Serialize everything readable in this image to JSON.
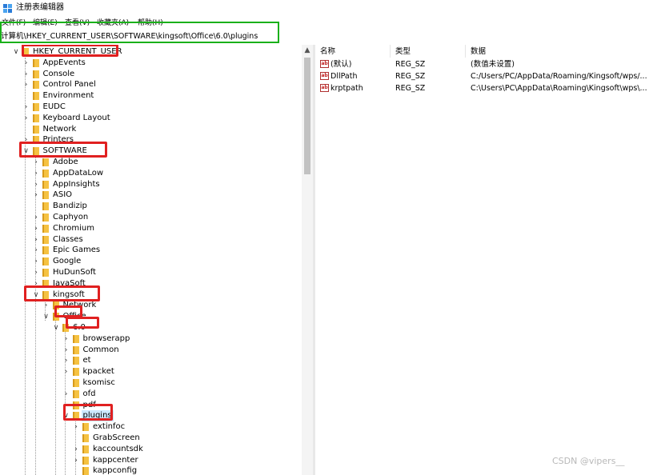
{
  "window": {
    "title": "注册表编辑器",
    "icon": "registry-editor-icon"
  },
  "menu": [
    "文件(F)",
    "编辑(E)",
    "查看(V)",
    "收藏夹(A)",
    "帮助(H)"
  ],
  "address": "计算机\\HKEY_CURRENT_USER\\SOFTWARE\\kingsoft\\Office\\6.0\\plugins",
  "tree": [
    {
      "label": "HKEY_CURRENT_USER",
      "chevron": "v"
    },
    {
      "label": "AppEvents",
      "chevron": ">"
    },
    {
      "label": "Console",
      "chevron": ">"
    },
    {
      "label": "Control Panel",
      "chevron": ">"
    },
    {
      "label": "Environment",
      "chevron": ""
    },
    {
      "label": "EUDC",
      "chevron": ">"
    },
    {
      "label": "Keyboard Layout",
      "chevron": ">"
    },
    {
      "label": "Network",
      "chevron": ""
    },
    {
      "label": "Printers",
      "chevron": ">"
    },
    {
      "label": "SOFTWARE",
      "chevron": "v"
    },
    {
      "label": "Adobe",
      "chevron": ">"
    },
    {
      "label": "AppDataLow",
      "chevron": ">"
    },
    {
      "label": "AppInsights",
      "chevron": ">"
    },
    {
      "label": "ASIO",
      "chevron": ">"
    },
    {
      "label": "Bandizip",
      "chevron": ""
    },
    {
      "label": "Caphyon",
      "chevron": ">"
    },
    {
      "label": "Chromium",
      "chevron": ">"
    },
    {
      "label": "Classes",
      "chevron": ">"
    },
    {
      "label": "Epic Games",
      "chevron": ">"
    },
    {
      "label": "Google",
      "chevron": ">"
    },
    {
      "label": "HuDunSoft",
      "chevron": ">"
    },
    {
      "label": "JavaSoft",
      "chevron": ">"
    },
    {
      "label": "kingsoft",
      "chevron": "v"
    },
    {
      "label": "Network",
      "chevron": ">"
    },
    {
      "label": "Office",
      "chevron": "v"
    },
    {
      "label": "6.0",
      "chevron": "v"
    },
    {
      "label": "browserapp",
      "chevron": ">"
    },
    {
      "label": "Common",
      "chevron": ">"
    },
    {
      "label": "et",
      "chevron": ">"
    },
    {
      "label": "kpacket",
      "chevron": ">"
    },
    {
      "label": "ksomisc",
      "chevron": ""
    },
    {
      "label": "ofd",
      "chevron": ">"
    },
    {
      "label": "pdf",
      "chevron": ">"
    },
    {
      "label": "plugins",
      "chevron": "v",
      "selected": true
    },
    {
      "label": "extinfoc",
      "chevron": ">"
    },
    {
      "label": "GrabScreen",
      "chevron": ""
    },
    {
      "label": "kaccountsdk",
      "chevron": ">"
    },
    {
      "label": "kappcenter",
      "chevron": ">"
    },
    {
      "label": "kappconfig",
      "chevron": ""
    }
  ],
  "list": {
    "columns": [
      "名称",
      "类型",
      "数据"
    ],
    "rows": [
      {
        "name": "(默认)",
        "type": "REG_SZ",
        "data": "(数值未设置)"
      },
      {
        "name": "DllPath",
        "type": "REG_SZ",
        "data": "C:/Users/PC/AppData/Roaming/Kingsoft/wps/..."
      },
      {
        "name": "krptpath",
        "type": "REG_SZ",
        "data": "C:\\Users\\PC\\AppData\\Roaming\\Kingsoft\\wps\\..."
      }
    ]
  },
  "value_icon_text": "ab",
  "watermark": "CSDN @vipers__",
  "colors": {
    "highlight_red": "#e02020",
    "highlight_green": "#1ab01a",
    "folder": "#f5c242",
    "selection": "#cce8ff"
  }
}
